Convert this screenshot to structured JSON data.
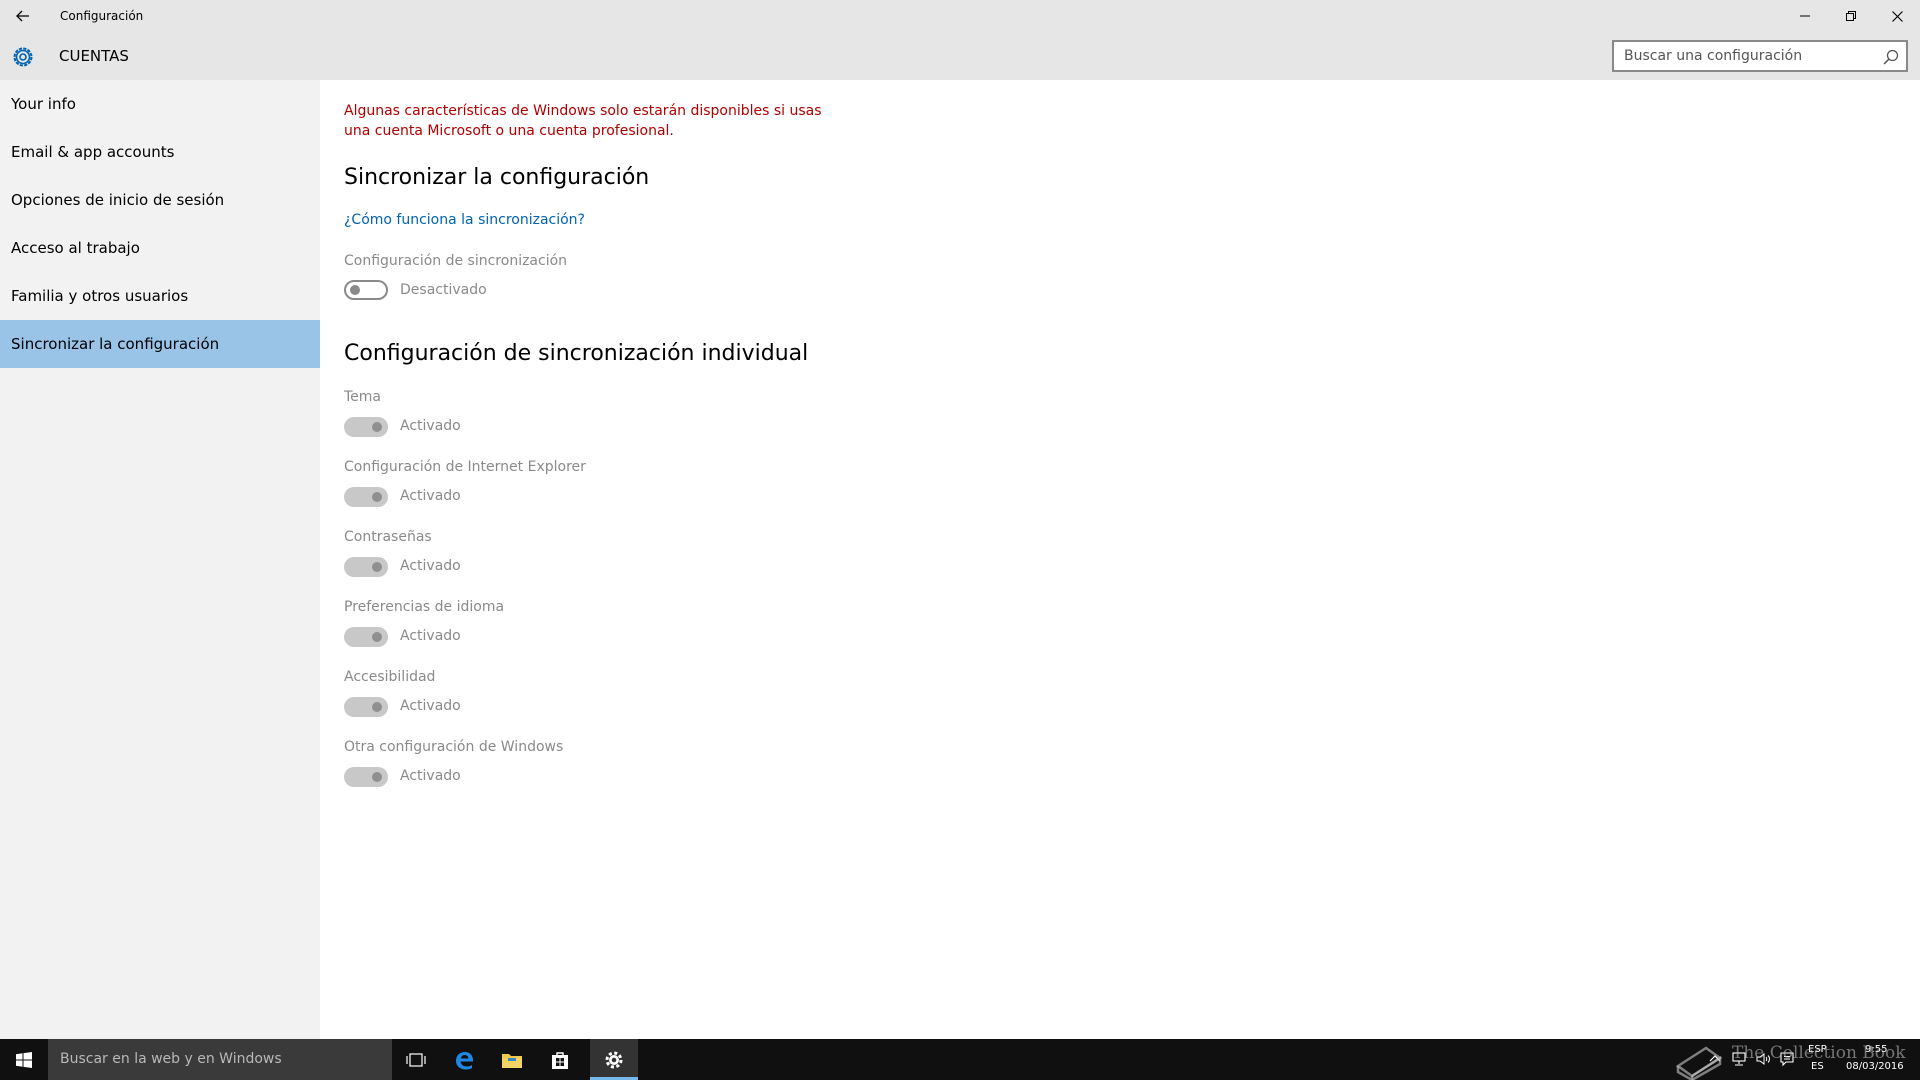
{
  "window": {
    "title": "Configuración"
  },
  "header": {
    "section_title": "CUENTAS",
    "search_placeholder": "Buscar una configuración"
  },
  "sidebar": {
    "items": [
      {
        "label": "Your info",
        "selected": false
      },
      {
        "label": "Email & app accounts",
        "selected": false
      },
      {
        "label": "Opciones de inicio de sesión",
        "selected": false
      },
      {
        "label": "Acceso al trabajo",
        "selected": false
      },
      {
        "label": "Familia y otros usuarios",
        "selected": false
      },
      {
        "label": "Sincronizar la configuración",
        "selected": true
      }
    ]
  },
  "content": {
    "warning_line1": "Algunas características de Windows solo estarán disponibles si usas",
    "warning_line2": "una cuenta Microsoft o una cuenta profesional.",
    "sync_heading": "Sincronizar la configuración",
    "sync_link": "¿Cómo funciona la sincronización?",
    "sync_setting": {
      "label": "Configuración de sincronización",
      "state": "Desactivado",
      "on": false
    },
    "individual_heading": "Configuración de sincronización individual",
    "individual_settings": [
      {
        "label": "Tema",
        "state": "Activado",
        "on": true
      },
      {
        "label": "Configuración de Internet Explorer",
        "state": "Activado",
        "on": true
      },
      {
        "label": "Contraseñas",
        "state": "Activado",
        "on": true
      },
      {
        "label": "Preferencias de idioma",
        "state": "Activado",
        "on": true
      },
      {
        "label": "Accesibilidad",
        "state": "Activado",
        "on": true
      },
      {
        "label": "Otra configuración de Windows",
        "state": "Activado",
        "on": true
      }
    ],
    "accent_color": "#0063b1",
    "warning_color": "#b00000"
  },
  "taskbar": {
    "search_text": "Buscar en la web y en Windows",
    "language_top": "ESP",
    "language_bottom": "ES",
    "time": "9:55",
    "date": "08/03/2016",
    "watermark": "The Collection Book"
  }
}
